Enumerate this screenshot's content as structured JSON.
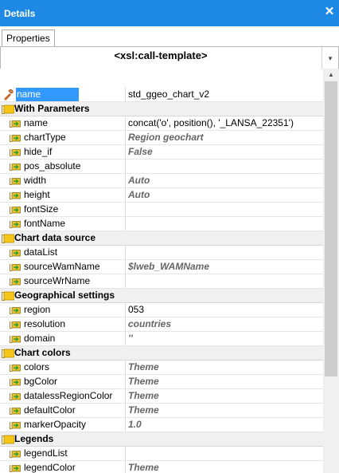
{
  "window": {
    "title": "Details",
    "close_glyph": "✕"
  },
  "tabs": [
    {
      "label": "Properties",
      "selected": true
    }
  ],
  "selector": {
    "value": "<xsl:call-template>",
    "dropdown_glyph": "▾"
  },
  "grid": {
    "top_row": {
      "name": "name",
      "value": "std_ggeo_chart_v2",
      "selected": true
    },
    "groups": [
      {
        "label": "With Parameters",
        "props": [
          {
            "name": "name",
            "value": "concat('o', position(), '_LANSA_22351')",
            "is_default": false
          },
          {
            "name": "chartType",
            "value": "Region geochart",
            "is_default": true
          },
          {
            "name": "hide_if",
            "value": "False",
            "is_default": true
          },
          {
            "name": "pos_absolute",
            "value": "",
            "is_default": false
          },
          {
            "name": "width",
            "value": "Auto",
            "is_default": true
          },
          {
            "name": "height",
            "value": "Auto",
            "is_default": true
          },
          {
            "name": "fontSize",
            "value": "",
            "is_default": false
          },
          {
            "name": "fontName",
            "value": "",
            "is_default": false
          }
        ]
      },
      {
        "label": "Chart data source",
        "props": [
          {
            "name": "dataList",
            "value": "",
            "is_default": false
          },
          {
            "name": "sourceWamName",
            "value": "$lweb_WAMName",
            "is_default": true
          },
          {
            "name": "sourceWrName",
            "value": "",
            "is_default": false
          }
        ]
      },
      {
        "label": "Geographical settings",
        "props": [
          {
            "name": "region",
            "value": "053",
            "is_default": false
          },
          {
            "name": "resolution",
            "value": "countries",
            "is_default": true
          },
          {
            "name": "domain",
            "value": "''",
            "is_default": true
          }
        ]
      },
      {
        "label": "Chart colors",
        "props": [
          {
            "name": "colors",
            "value": "Theme",
            "is_default": true
          },
          {
            "name": "bgColor",
            "value": "Theme",
            "is_default": true
          },
          {
            "name": "datalessRegionColor",
            "value": "Theme",
            "is_default": true
          },
          {
            "name": "defaultColor",
            "value": "Theme",
            "is_default": true
          },
          {
            "name": "markerOpacity",
            "value": "1.0",
            "is_default": true
          }
        ]
      },
      {
        "label": "Legends",
        "props": [
          {
            "name": "legendList",
            "value": "",
            "is_default": false
          },
          {
            "name": "legendColor",
            "value": "Theme",
            "is_default": true
          }
        ]
      }
    ]
  },
  "icons": {
    "group": "folder-icon",
    "property": "parameter-icon",
    "top": "tool-icon"
  },
  "colors": {
    "titlebar": "#1e88e5",
    "selection": "#3399ff",
    "group_bg": "#f0f0f0",
    "default_value": "#666666",
    "folder": "#f5c518",
    "param_arrow": "#2e9e2e"
  },
  "scrollbar": {
    "up_glyph": "▲"
  }
}
